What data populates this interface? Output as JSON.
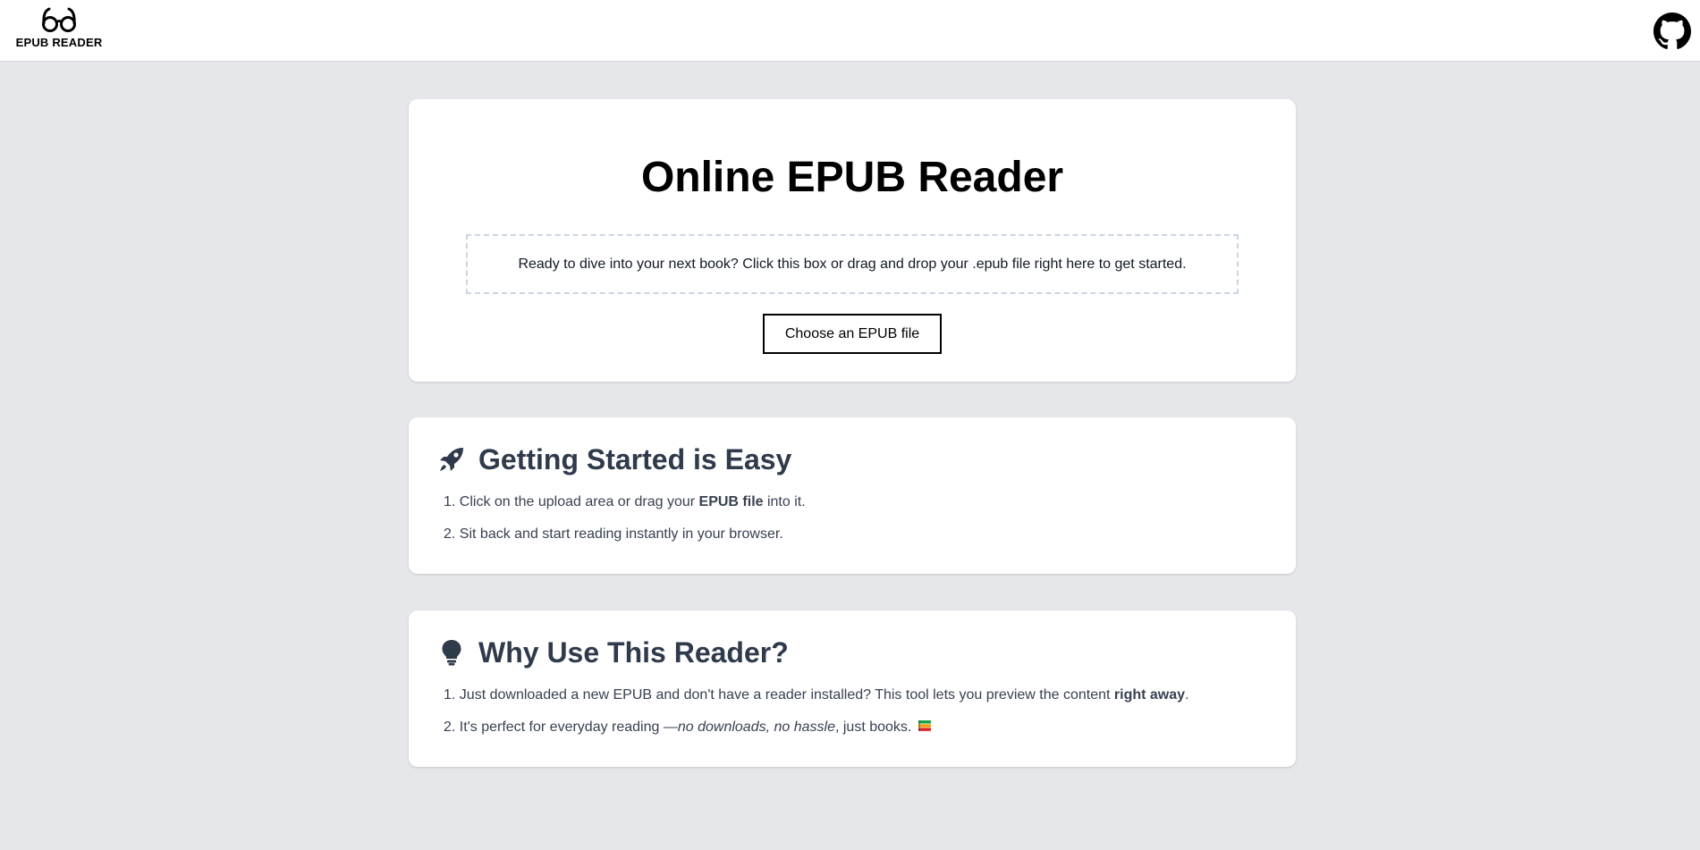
{
  "header": {
    "logo_text": "EPUB READER",
    "logo_icon": "glasses-icon",
    "github_icon": "github-icon"
  },
  "upload": {
    "title": "Online EPUB Reader",
    "dropzone_text": "Ready to dive into your next book? Click this box or drag and drop your .epub file right here to get started.",
    "button_label": "Choose an EPUB file"
  },
  "getting_started": {
    "icon": "rocket-icon",
    "title": "Getting Started is Easy",
    "steps": [
      {
        "number": "1.",
        "before": "Click on the upload area or drag your ",
        "bold": "EPUB file",
        "after": " into it."
      },
      {
        "number": "2.",
        "text": "Sit back and start reading instantly in your browser."
      }
    ]
  },
  "why": {
    "icon": "lightbulb-icon",
    "title": "Why Use This Reader?",
    "points": [
      {
        "number": "1.",
        "before": "Just downloaded a new EPUB and don't have a reader installed? This tool lets you preview the content ",
        "bold": "right away",
        "after": "."
      },
      {
        "number": "2.",
        "before": "It's perfect for everyday reading —",
        "italic": "no downloads, no hassle",
        "after": ", just books.",
        "emoji": "books-emoji-icon"
      }
    ]
  },
  "colors": {
    "page_background": "#e5e7eb",
    "card_background": "#ffffff",
    "heading_dark": "#2f3a4b",
    "text": "#374151",
    "dashed_border": "#cbd5e1"
  }
}
